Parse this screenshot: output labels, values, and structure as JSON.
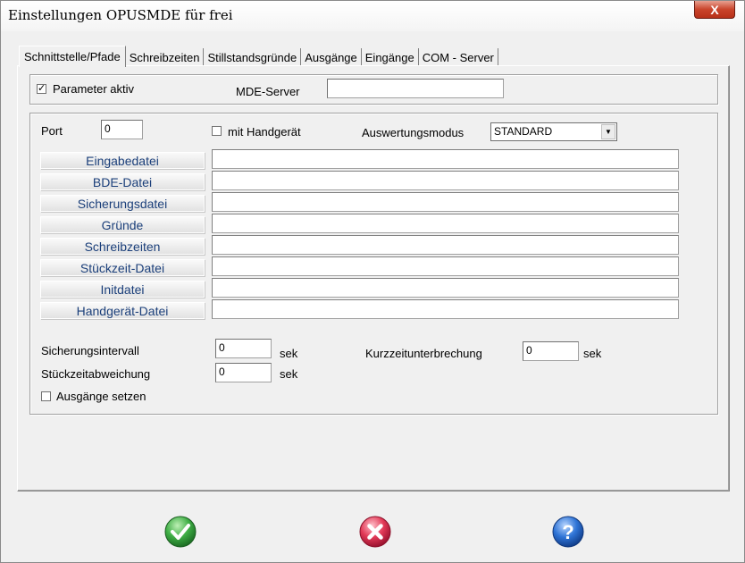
{
  "window": {
    "title": "Einstellungen OPUSMDE für frei",
    "close_glyph": "X"
  },
  "tabs": [
    {
      "label": "Schnittstelle/Pfade",
      "active": true
    },
    {
      "label": "Schreibzeiten"
    },
    {
      "label": "Stillstandsgründe"
    },
    {
      "label": "Ausgänge"
    },
    {
      "label": "Eingänge"
    },
    {
      "label": "COM - Server"
    }
  ],
  "params": {
    "active_label": "Parameter aktiv",
    "active_checked": "✓",
    "mde_server_label": "MDE-Server",
    "mde_server_value": ""
  },
  "config": {
    "port_label": "Port",
    "port_value": "0",
    "handgeraet_label": "mit Handgerät",
    "mode_label": "Auswertungsmodus",
    "mode_value": "STANDARD"
  },
  "files": {
    "eingabedatei": {
      "label": "Eingabedatei",
      "value": ""
    },
    "bde_datei": {
      "label": "BDE-Datei",
      "value": ""
    },
    "sicherungsdatei": {
      "label": "Sicherungsdatei",
      "value": ""
    },
    "gruende": {
      "label": "Gründe",
      "value": ""
    },
    "schreibzeiten": {
      "label": "Schreibzeiten",
      "value": ""
    },
    "stueckzeit_datei": {
      "label": "Stückzeit-Datei",
      "value": ""
    },
    "initdatei": {
      "label": "Initdatei",
      "value": ""
    },
    "handgeraet_datei": {
      "label": "Handgerät-Datei",
      "value": ""
    }
  },
  "timing": {
    "sicherungsintervall_label": "Sicherungsintervall",
    "sicherungsintervall_value": "0",
    "sicherungsintervall_unit": "sek",
    "kurzzeit_label": "Kurzzeitunterbrechung",
    "kurzzeit_value": "0",
    "kurzzeit_unit": "sek",
    "stueckzeit_label": "Stückzeitabweichung",
    "stueckzeit_value": "0",
    "stueckzeit_unit": "sek",
    "ausgaenge_label": "Ausgänge setzen"
  },
  "buttons": {
    "ok_icon": "check-icon",
    "cancel_icon": "x-icon",
    "help_icon": "question-icon",
    "help_glyph": "?",
    "ok_color": "#2f9a3a",
    "cancel_color": "#d82c4a",
    "help_color": "#1f5fb8"
  }
}
